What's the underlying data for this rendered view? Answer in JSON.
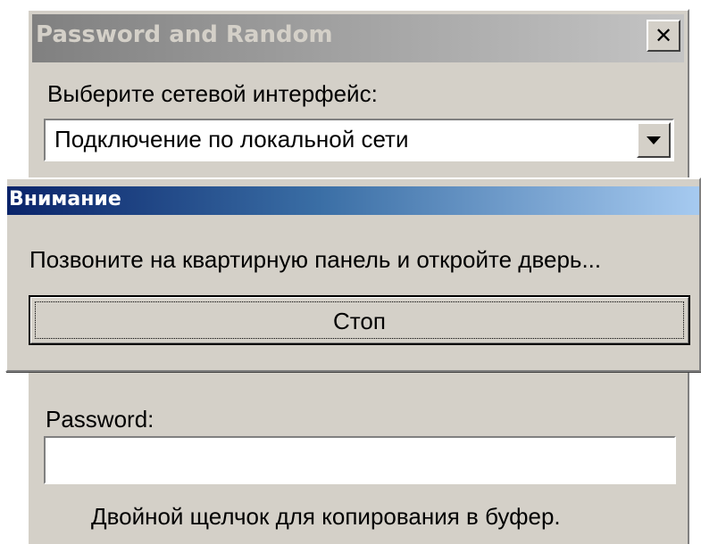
{
  "main_window": {
    "title": "Password and Random",
    "close_glyph": "✕",
    "interface_label": "Выберите сетевой интерфейс:",
    "interface_selected": "Подключение по локальной сети",
    "password_label": "Password:",
    "password_value": "",
    "copy_hint": "Двойной щелчок для копирования в буфер."
  },
  "dialog": {
    "title": "Внимание",
    "message": "Позвоните на квартирную панель и откройте дверь...",
    "stop_label": "Стоп"
  },
  "colors": {
    "window_face": "#d4d0c8",
    "active_title_start": "#0a246a",
    "active_title_end": "#a6caf0",
    "inactive_title_start": "#808080",
    "inactive_title_end": "#c4c4c4"
  },
  "icons": {
    "close": "close-icon",
    "dropdown": "chevron-down-icon"
  }
}
